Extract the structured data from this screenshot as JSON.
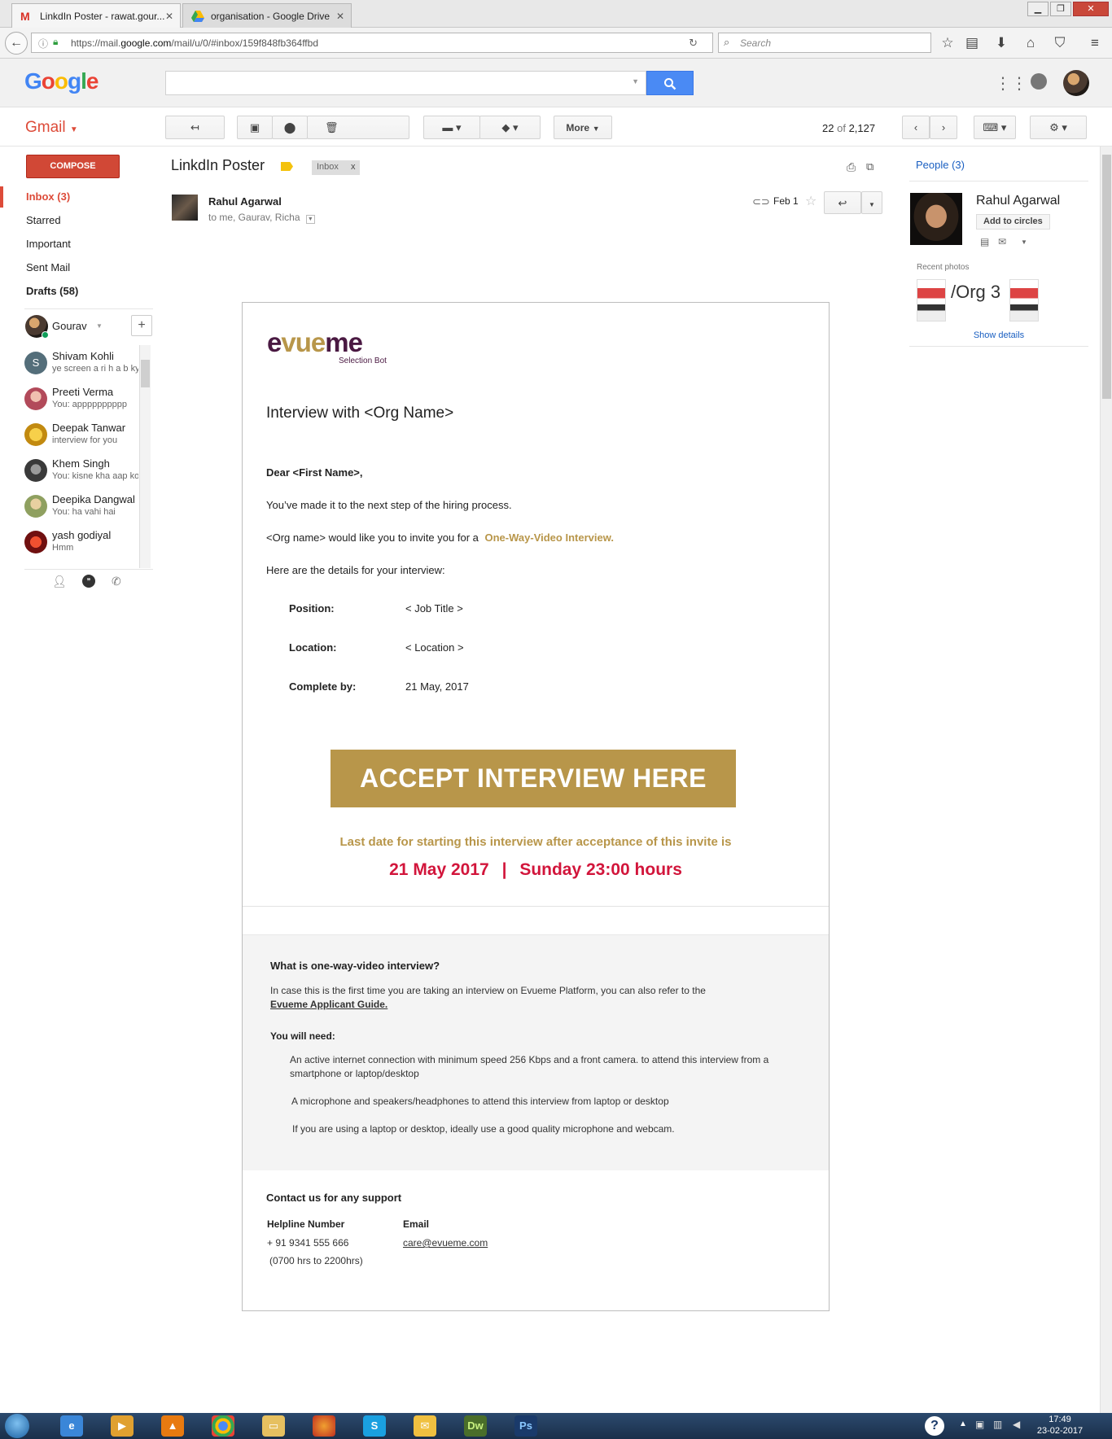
{
  "browser": {
    "tabs": [
      {
        "title": "LinkdIn Poster - rawat.gour...",
        "active": true
      },
      {
        "title": "organisation - Google Drive",
        "active": false
      }
    ],
    "url_prefix": "https://mail.",
    "url_domain": "google.com",
    "url_rest": "/mail/u/0/#inbox/159f848fb364ffbd",
    "search_placeholder": "Search"
  },
  "google": {
    "logo": "Google",
    "colors": {
      "blue": "#4285f4",
      "red": "#ea4335",
      "yellow": "#fbbc05",
      "green": "#34a853"
    }
  },
  "gmail": {
    "label": "Gmail",
    "toolbar": {
      "more_label": "More",
      "counter_position": "22",
      "counter_of": "of",
      "counter_total": "2,127"
    },
    "compose_label": "COMPOSE",
    "nav": [
      {
        "label": "Inbox (3)",
        "active": true
      },
      {
        "label": "Starred",
        "active": false
      },
      {
        "label": "Important",
        "active": false
      },
      {
        "label": "Sent Mail",
        "active": false
      },
      {
        "label": "Drafts (58)",
        "active": false
      }
    ],
    "hangouts": {
      "me": "Gourav",
      "contacts": [
        {
          "name": "Shivam Kohli",
          "snippet": "ye screen a ri h a b ky",
          "initial": "S"
        },
        {
          "name": "Preeti Verma",
          "snippet": "You: apppppppppp",
          "initial": ""
        },
        {
          "name": "Deepak Tanwar",
          "snippet": "interview for you",
          "initial": ""
        },
        {
          "name": "Khem Singh",
          "snippet": "You: kisne kha aap ko",
          "initial": ""
        },
        {
          "name": "Deepika Dangwal",
          "snippet": "You: ha vahi hai",
          "initial": ""
        },
        {
          "name": "yash godiyal",
          "snippet": "Hmm",
          "initial": ""
        }
      ]
    }
  },
  "message": {
    "subject": "LinkdIn Poster",
    "label": "Inbox",
    "label_close": "x",
    "sender": "Rahul Agarwal",
    "recipients": "to me, Gaurav, Richa",
    "date": "Feb 1"
  },
  "email": {
    "logo_main": "evueme",
    "logo_sub": "Selection Bot",
    "heading": "Interview with <Org Name>",
    "greeting": "Dear <First Name>,",
    "line1": "You’ve made it to the next step of the hiring process.",
    "line2_prefix": "<Org name> would like you to invite you for a",
    "line2_link": "One-Way-Video Interview.",
    "line3": "Here are the details for your interview:",
    "details": [
      {
        "label": "Position:",
        "value": "< Job Title >"
      },
      {
        "label": "Location:",
        "value": "< Location >"
      },
      {
        "label": "Complete by:",
        "value": "21 May, 2017"
      }
    ],
    "accept_button": "ACCEPT INTERVIEW HERE",
    "deadline_note": "Last date for starting this interview after acceptance of this invite is",
    "deadline_date": "21 May 2017",
    "deadline_sep": "|",
    "deadline_time": "Sunday 23:00 hours",
    "faq": {
      "title": "What is one-way-video interview?",
      "intro": "In case this is the first time you are taking an interview on Evueme Platform, you can also refer to the",
      "guide_link": "Evueme Applicant Guide.",
      "need_title": "You will need:",
      "needs": [
        "An active internet connection with minimum speed 256 Kbps and a front camera. to attend this interview from a smartphone or laptop/desktop",
        "A microphone and speakers/headphones to attend this interview from laptop or desktop",
        "If you are using a laptop or desktop, ideally use a good quality microphone and webcam."
      ]
    },
    "contact": {
      "title": "Contact us for any support",
      "helpline_label": "Helpline Number",
      "helpline": "+ 91 9341 555 666",
      "hours": "(0700 hrs to  2200hrs)",
      "email_label": "Email",
      "email": "care@evueme.com"
    },
    "colors": {
      "gold": "#b8964a",
      "crimson": "#d2153b",
      "logo_purple": "#4a1942"
    }
  },
  "people": {
    "header": "People (3)",
    "name": "Rahul Agarwal",
    "add_circles": "Add to circles",
    "recent_photos": "Recent photos",
    "photo_caption": "/Org 3",
    "show_details": "Show details"
  },
  "taskbar": {
    "time": "17:49",
    "date": "23-02-2017",
    "apps": [
      "Dw",
      "Ps"
    ]
  }
}
